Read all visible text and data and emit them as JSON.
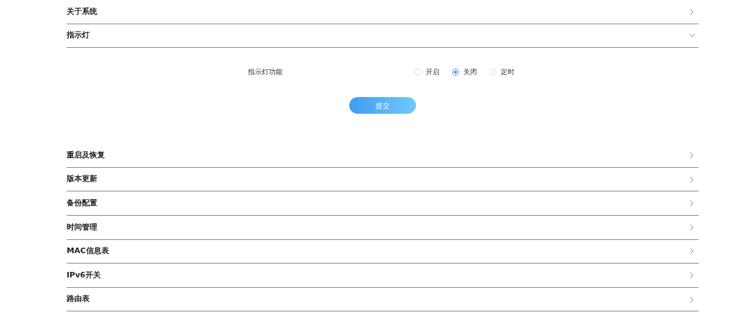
{
  "sections": [
    {
      "title": "关于系统",
      "expanded": false
    },
    {
      "title": "指示灯",
      "expanded": true,
      "form": {
        "label": "指示灯功能",
        "options": [
          {
            "label": "开启",
            "selected": false
          },
          {
            "label": "关闭",
            "selected": true
          },
          {
            "label": "定时",
            "selected": false
          }
        ],
        "submit": "提交"
      }
    },
    {
      "title": "重启及恢复",
      "expanded": false
    },
    {
      "title": "版本更新",
      "expanded": false
    },
    {
      "title": "备份配置",
      "expanded": false
    },
    {
      "title": "时间管理",
      "expanded": false
    },
    {
      "title": "MAC信息表",
      "expanded": false
    },
    {
      "title": "IPv6开关",
      "expanded": false
    },
    {
      "title": "路由表",
      "expanded": false
    }
  ]
}
